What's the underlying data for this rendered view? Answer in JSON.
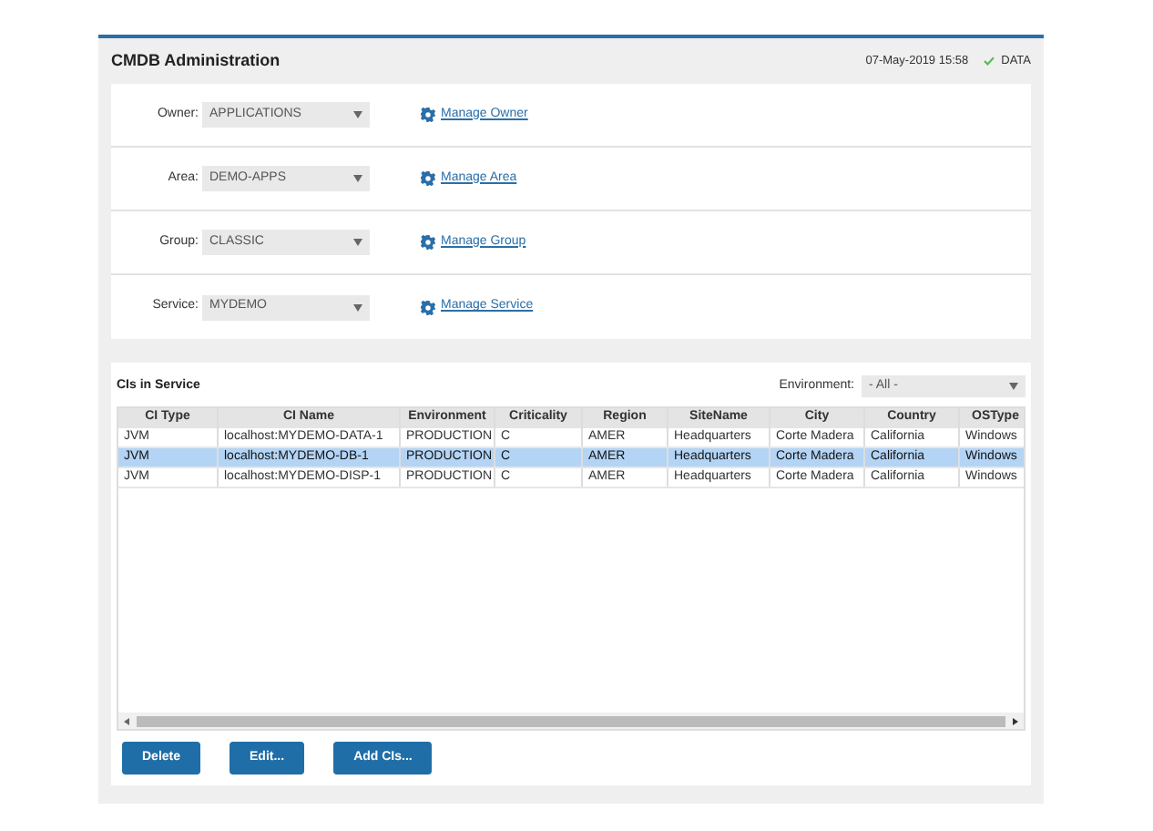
{
  "header": {
    "title": "CMDB Administration",
    "timestamp": "07-May-2019 15:58",
    "status": "DATA"
  },
  "filters": [
    {
      "label": "Owner:",
      "value": "APPLICATIONS",
      "link": "Manage Owner"
    },
    {
      "label": "Area:",
      "value": "DEMO-APPS",
      "link": "Manage Area"
    },
    {
      "label": "Group:",
      "value": "CLASSIC",
      "link": "Manage Group"
    },
    {
      "label": "Service:",
      "value": "MYDEMO",
      "link": "Manage Service"
    }
  ],
  "cis": {
    "title": "CIs in Service",
    "environment_label": "Environment:",
    "environment_value": "- All -",
    "columns": [
      "CI Type",
      "CI Name",
      "Environment",
      "Criticality",
      "Region",
      "SiteName",
      "City",
      "Country",
      "OSType"
    ],
    "rows": [
      {
        "cells": [
          "JVM",
          "localhost:MYDEMO-DATA-1",
          "PRODUCTION",
          "C",
          "AMER",
          "Headquarters",
          "Corte Madera",
          "California",
          "Windows"
        ],
        "selected": false
      },
      {
        "cells": [
          "JVM",
          "localhost:MYDEMO-DB-1",
          "PRODUCTION",
          "C",
          "AMER",
          "Headquarters",
          "Corte Madera",
          "California",
          "Windows"
        ],
        "selected": true
      },
      {
        "cells": [
          "JVM",
          "localhost:MYDEMO-DISP-1",
          "PRODUCTION",
          "C",
          "AMER",
          "Headquarters",
          "Corte Madera",
          "California",
          "Windows"
        ],
        "selected": false
      }
    ]
  },
  "buttons": [
    "Delete",
    "Edit...",
    "Add CIs..."
  ]
}
